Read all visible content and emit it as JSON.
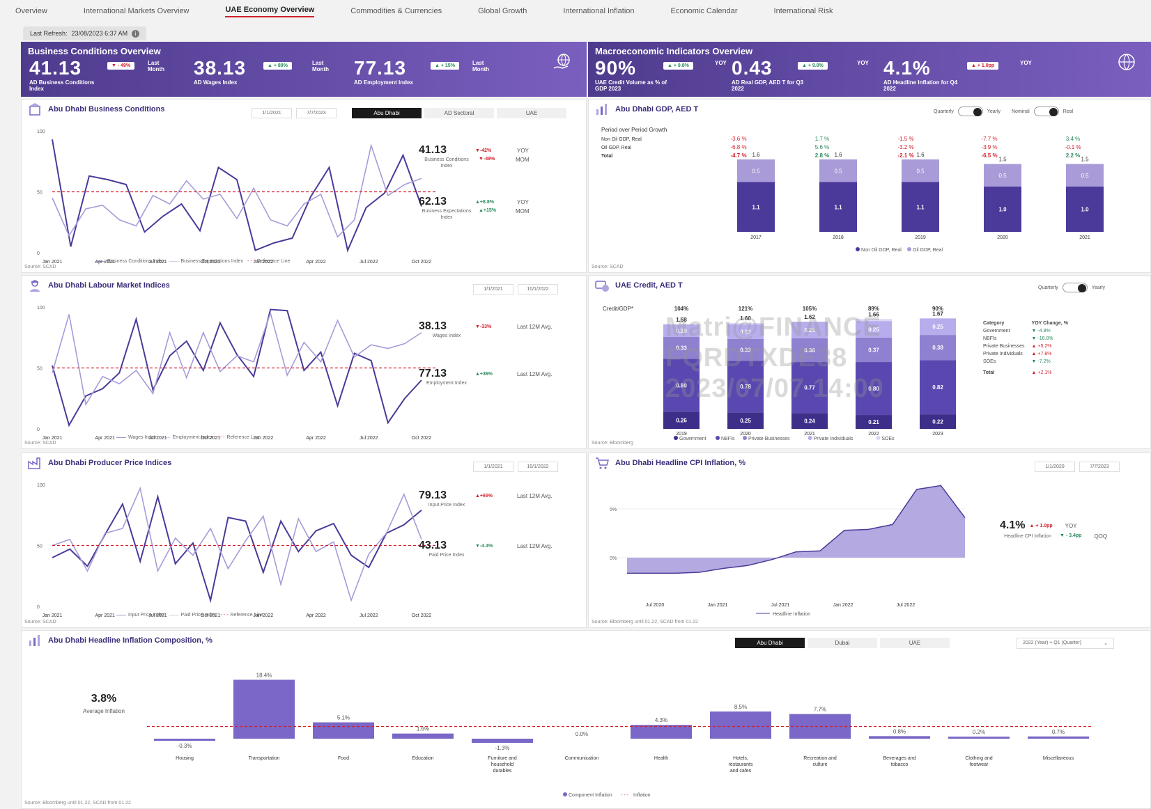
{
  "nav": {
    "tabs": [
      "Overview",
      "International Markets Overview",
      "UAE Economy Overview",
      "Commodities & Currencies",
      "Global Growth",
      "International Inflation",
      "Economic Calendar",
      "International Risk"
    ],
    "active": 2
  },
  "refresh": {
    "label": "Last Refresh:",
    "value": "23/08/2023 6:37 AM"
  },
  "business_banner": {
    "title": "Business Conditions Overview",
    "kpis": [
      {
        "value": "41.13",
        "delta": "▼ - 49%",
        "delta_dir": "down",
        "period": "Last Month",
        "label": "AD Business Conditions Index"
      },
      {
        "value": "38.13",
        "delta": "▲ + 89%",
        "delta_dir": "up",
        "period": "Last Month",
        "label": "AD Wages Index"
      },
      {
        "value": "77.13",
        "delta": "▲ + 15%",
        "delta_dir": "up",
        "period": "Last Month",
        "label": "AD Employment Index"
      }
    ]
  },
  "macro_banner": {
    "title": "Macroeconomic Indicators Overview",
    "kpis": [
      {
        "value": "90%",
        "delta": "▲ + 9.8%",
        "delta_dir": "up",
        "period": "YOY",
        "label": "UAE Credit Volume as % of GDP 2023"
      },
      {
        "value": "0.43",
        "delta": "▲ + 9.8%",
        "delta_dir": "up",
        "period": "YOY",
        "label": "AD Real GDP, AED T for Q3 2022"
      },
      {
        "value": "4.1%",
        "delta": "▲ + 1.0pp",
        "delta_dir": "down",
        "period": "YOY",
        "label": "AD Headline Inflation for Q4 2022"
      }
    ]
  },
  "business_conditions": {
    "title": "Abu Dhabi Business Conditions",
    "dates": [
      "1/1/2021",
      "7/7/2023"
    ],
    "segments": [
      "Abu Dhabi",
      "AD Sectoral",
      "UAE"
    ],
    "stats": [
      {
        "value": "41.13",
        "label": "Business Conditions Index",
        "d1": "▼-42%",
        "p1": "YOY",
        "d2": "▼-49%",
        "p2": "MOM",
        "dir1": "down",
        "dir2": "down"
      },
      {
        "value": "62.13",
        "label": "Business Expectations Index",
        "d1": "▲+8.8%",
        "p1": "YOY",
        "d2": "▲+15%",
        "p2": "MOM",
        "dir1": "up",
        "dir2": "up"
      }
    ],
    "legend": [
      "Business Conditions Index",
      "Business Expectations Index",
      "Reference Line"
    ],
    "source": "Source: SCAD"
  },
  "labour": {
    "title": "Abu Dhabi Labour Market Indices",
    "dates": [
      "1/1/2021",
      "10/1/2022"
    ],
    "stats": [
      {
        "value": "38.13",
        "label": "Wages Index",
        "d1": "▼-33%",
        "p1": "Last 12M Avg.",
        "dir1": "down"
      },
      {
        "value": "77.13",
        "label": "Employment Index",
        "d1": "▲+36%",
        "p1": "Last 12M Avg.",
        "dir1": "up"
      }
    ],
    "legend": [
      "Wages Index",
      "Employment Index",
      "Reference Line"
    ],
    "source": "Source: SCAD"
  },
  "ppi": {
    "title": "Abu Dhabi Producer Price Indices",
    "dates": [
      "1/1/2021",
      "10/1/2022"
    ],
    "stats": [
      {
        "value": "79.13",
        "label": "Input Price Index",
        "d1": "▲+65%",
        "p1": "Last 12M Avg.",
        "dir1": "down"
      },
      {
        "value": "43.13",
        "label": "Paid Price Index",
        "d1": "▼-4.4%",
        "p1": "Last 12M Avg.",
        "dir1": "up"
      }
    ],
    "legend": [
      "Input Price Index",
      "Paid Price Index",
      "Reference Line"
    ],
    "source": "Source: SCAD"
  },
  "gdp": {
    "title": "Abu Dhabi GDP, AED T",
    "toggles": [
      "Quarterly",
      "Yearly",
      "Nominal",
      "Real"
    ],
    "growth_title": "Period over Period Growth",
    "growth_rows": [
      {
        "label": "Non Oil GDP, Real",
        "vals": [
          "-3.6 %",
          "1.7 %",
          "-1.5 %",
          "-7.7 %",
          "3.4 %"
        ]
      },
      {
        "label": "Oil GDP, Real",
        "vals": [
          "-6.8 %",
          "5.6 %",
          "-3.2 %",
          "-3.9 %",
          "-0.1 %"
        ]
      },
      {
        "label": "Total",
        "vals": [
          "-4.7 %",
          "2.8 %",
          "-2.1 %",
          "-6.5 %",
          "2.2 %"
        ]
      }
    ],
    "legend": [
      "Non Oil GDP, Real",
      "Oil GDP, Real"
    ],
    "source": "Source: SCAD"
  },
  "credit": {
    "title": "UAE Credit, AED T",
    "toggles": [
      "Quarterly",
      "Yearly"
    ],
    "ratio_label": "Credit/GDP*",
    "ratios": [
      "104%",
      "121%",
      "105%",
      "89%",
      "90%"
    ],
    "table_head": [
      "Category",
      "YOY Change, %"
    ],
    "table": [
      {
        "c": "Government",
        "v": "▼ -4.8%",
        "dir": "down"
      },
      {
        "c": "NBFIs",
        "v": "▼ -18.8%",
        "dir": "down"
      },
      {
        "c": "Private Businesses",
        "v": "▲ +5.2%",
        "dir": "up"
      },
      {
        "c": "Private Individuals",
        "v": "▲ +7.8%",
        "dir": "up"
      },
      {
        "c": "SOEs",
        "v": "▼ -7.2%",
        "dir": "down"
      },
      {
        "c": "Total",
        "v": "▲ +2.1%",
        "dir": "up"
      }
    ],
    "legend": [
      "Government",
      "NBFIs",
      "Private Businesses",
      "Private Individuals",
      "SOEs"
    ],
    "source": "Source: Bloomberg",
    "watermark": [
      "Matri@FINANCE",
      "FQRDTXDE38",
      "2023/07/07 14:00"
    ]
  },
  "cpi": {
    "title": "Abu Dhabi Headline CPI Inflation, %",
    "dates": [
      "1/1/2020",
      "7/7/2023"
    ],
    "stat": {
      "value": "4.1%",
      "label": "Headline CPI Inflation",
      "d1": "▲ + 1.0pp",
      "p1": "YOY",
      "d2": "▼ - 3.4pp",
      "p2": "QOQ"
    },
    "legend": [
      "Headline Inflation"
    ],
    "source": "Source: Bloomberg until 01.22, SCAD from 01.22"
  },
  "composition": {
    "title": "Abu Dhabi Headline Inflation Composition, %",
    "segments": [
      "Abu Dhabi",
      "Dubai",
      "UAE"
    ],
    "dropdown": "2022 (Year) + Q1 (Quarter)",
    "avg": {
      "value": "3.8%",
      "label": "Average Inflation"
    },
    "legend": [
      "Component Inflation",
      "Inflation"
    ],
    "source": "Source: Bloomberg until 01.22, SCAD from 01.22"
  },
  "chart_data": [
    {
      "type": "line",
      "title": "Abu Dhabi Business Conditions",
      "x": [
        "Jan 2021",
        "Apr 2021",
        "Jul 2021",
        "Oct 2021",
        "Jan 2022",
        "Apr 2022",
        "Jul 2022",
        "Oct 2022"
      ],
      "ylim": [
        0,
        100
      ],
      "series": [
        {
          "name": "Business Conditions Index",
          "values": [
            93,
            5,
            63,
            60,
            56,
            17,
            30,
            40,
            18,
            70,
            60,
            2,
            8,
            12,
            46,
            70,
            2,
            37,
            49,
            80,
            38
          ]
        },
        {
          "name": "Business Expectations Index",
          "values": [
            45,
            14,
            36,
            39,
            27,
            22,
            47,
            40,
            59,
            44,
            48,
            28,
            53,
            27,
            22,
            40,
            48,
            13,
            27,
            88,
            47,
            56,
            61
          ]
        },
        {
          "name": "Reference Line",
          "values": [
            50
          ]
        }
      ]
    },
    {
      "type": "line",
      "title": "Abu Dhabi Labour Market Indices",
      "x": [
        "Jan 2021",
        "Apr 2021",
        "Jul 2021",
        "Oct 2021",
        "Jan 2022",
        "Apr 2022",
        "Jul 2022",
        "Oct 2022"
      ],
      "ylim": [
        0,
        100
      ],
      "series": [
        {
          "name": "Wages Index",
          "values": [
            52,
            3,
            27,
            33,
            46,
            90,
            32,
            60,
            72,
            48,
            87,
            61,
            43,
            98,
            97,
            48,
            63,
            19,
            62,
            56,
            5,
            25,
            40
          ]
        },
        {
          "name": "Employment Index",
          "values": [
            46,
            94,
            20,
            43,
            37,
            48,
            29,
            79,
            42,
            79,
            47,
            60,
            55,
            95,
            44,
            71,
            55,
            89,
            59,
            69,
            66,
            70,
            79
          ]
        },
        {
          "name": "Reference Line",
          "values": [
            50
          ]
        }
      ]
    },
    {
      "type": "line",
      "title": "Abu Dhabi Producer Price Indices",
      "x": [
        "Jan 2021",
        "Apr 2021",
        "Jul 2021",
        "Oct 2021",
        "Jan 2022",
        "Apr 2022",
        "Jul 2022",
        "Oct 2022"
      ],
      "ylim": [
        0,
        100
      ],
      "series": [
        {
          "name": "Input Price Index",
          "values": [
            40,
            47,
            33,
            59,
            84,
            37,
            90,
            35,
            52,
            5,
            73,
            70,
            28,
            70,
            45,
            62,
            68,
            42,
            32,
            60,
            67,
            79
          ]
        },
        {
          "name": "Paid Price Index",
          "values": [
            50,
            55,
            29,
            60,
            64,
            97,
            29,
            56,
            42,
            64,
            31,
            54,
            74,
            18,
            72,
            45,
            53,
            5,
            43,
            60,
            92,
            55
          ]
        },
        {
          "name": "Reference Line",
          "values": [
            50
          ]
        }
      ]
    },
    {
      "type": "bar",
      "title": "Abu Dhabi GDP, AED T",
      "categories": [
        "2017",
        "2018",
        "2019",
        "2020",
        "2021"
      ],
      "series": [
        {
          "name": "Non Oil GDP, Real",
          "values": [
            1.1,
            1.1,
            1.1,
            1.0,
            1.0
          ]
        },
        {
          "name": "Oil GDP, Real",
          "values": [
            0.5,
            0.5,
            0.5,
            0.5,
            0.5
          ]
        }
      ],
      "totals": [
        1.6,
        1.6,
        1.6,
        1.5,
        1.5
      ]
    },
    {
      "type": "bar",
      "title": "UAE Credit, AED T",
      "categories": [
        "2019",
        "2020",
        "2021",
        "2022",
        "2023"
      ],
      "series": [
        {
          "name": "Government",
          "values": [
            0.26,
            0.25,
            0.24,
            0.21,
            0.22
          ]
        },
        {
          "name": "NBFIs",
          "values": [
            0.8,
            0.78,
            0.77,
            0.8,
            0.82
          ]
        },
        {
          "name": "Private Businesses",
          "values": [
            0.33,
            0.33,
            0.36,
            0.37,
            0.38
          ]
        },
        {
          "name": "Private Individuals",
          "values": [
            0.19,
            0.22,
            0.25,
            0.25,
            0.25
          ]
        },
        {
          "name": "SOEs",
          "values": [
            0.0,
            0.02,
            0.0,
            0.03,
            0.0
          ]
        }
      ],
      "totals": [
        1.58,
        1.6,
        1.62,
        1.66,
        1.67
      ]
    },
    {
      "type": "area",
      "title": "Abu Dhabi Headline CPI Inflation, %",
      "x": [
        "Jul 2020",
        "Jan 2021",
        "Jul 2021",
        "Jan 2022",
        "Jul 2022"
      ],
      "yticks": [
        "5%",
        "0%"
      ],
      "values": [
        -1.6,
        -1.6,
        -1.6,
        -1.5,
        -1.1,
        -0.8,
        -0.2,
        0.6,
        0.7,
        2.8,
        2.9,
        3.4,
        7.0,
        7.4,
        4.1
      ]
    },
    {
      "type": "bar",
      "title": "Abu Dhabi Headline Inflation Composition, %",
      "categories": [
        "Housing",
        "Transportation",
        "Food",
        "Education",
        "Furniture and household durables",
        "Communication",
        "Health",
        "Hotels, restaurants and cafes",
        "Recreation and culture",
        "Beverages and tobacco",
        "Clothing and footwear",
        "Miscellaneous"
      ],
      "values": [
        -0.3,
        18.4,
        5.1,
        1.6,
        -1.3,
        0.0,
        4.3,
        8.5,
        7.7,
        0.8,
        0.2,
        0.7
      ],
      "labels": [
        "-0.3%",
        "18.4%",
        "5.1%",
        "1.6%",
        "-1.3%",
        "0.0%",
        "4.3%",
        "8.5%",
        "7.7%",
        "0.8%",
        "0.2%",
        "0.7%"
      ],
      "reference": 3.8
    }
  ]
}
